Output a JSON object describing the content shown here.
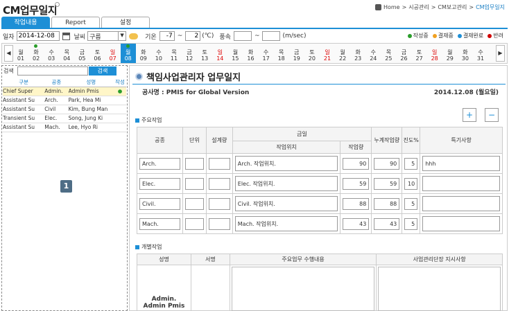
{
  "app": {
    "title": "CM업무일지"
  },
  "breadcrumb": {
    "home": "Home",
    "level1": "시공관리",
    "level2": "CM보고관리",
    "current": "CM업무일지"
  },
  "tabs": [
    {
      "label": "작업내용"
    },
    {
      "label": "Report"
    },
    {
      "label": "설정"
    }
  ],
  "toolbar": {
    "date_label": "일자",
    "date_value": "2014-12-08",
    "weather_label": "날씨",
    "weather_value": "구름",
    "temp_label": "기온",
    "temp_min": "-7",
    "temp_sep": "~",
    "temp_max": "2",
    "temp_unit": "(℃)",
    "wind_label": "풍속",
    "wind_min": "",
    "wind_sep": "~",
    "wind_max": "",
    "wind_unit": "(m/sec)"
  },
  "status_legend": [
    {
      "label": "작성중",
      "color": "#2a9d2a"
    },
    {
      "label": "결재중",
      "color": "#f0a020"
    },
    {
      "label": "결재완료",
      "color": "#1d8fd6"
    },
    {
      "label": "반려",
      "color": "#d00000"
    }
  ],
  "calendar": {
    "days": [
      {
        "w": "월",
        "d": "01"
      },
      {
        "w": "화",
        "d": "02",
        "dot": true
      },
      {
        "w": "수",
        "d": "03"
      },
      {
        "w": "목",
        "d": "04"
      },
      {
        "w": "금",
        "d": "05"
      },
      {
        "w": "토",
        "d": "06"
      },
      {
        "w": "일",
        "d": "07",
        "red": true
      },
      {
        "w": "월",
        "d": "08",
        "sel": true,
        "dot": true
      },
      {
        "w": "화",
        "d": "09"
      },
      {
        "w": "수",
        "d": "10"
      },
      {
        "w": "목",
        "d": "11"
      },
      {
        "w": "금",
        "d": "12"
      },
      {
        "w": "토",
        "d": "13"
      },
      {
        "w": "일",
        "d": "14",
        "red": true
      },
      {
        "w": "월",
        "d": "15"
      },
      {
        "w": "화",
        "d": "16"
      },
      {
        "w": "수",
        "d": "17"
      },
      {
        "w": "목",
        "d": "18"
      },
      {
        "w": "금",
        "d": "19"
      },
      {
        "w": "토",
        "d": "20"
      },
      {
        "w": "일",
        "d": "21",
        "red": true
      },
      {
        "w": "월",
        "d": "22"
      },
      {
        "w": "화",
        "d": "23"
      },
      {
        "w": "수",
        "d": "24"
      },
      {
        "w": "목",
        "d": "25"
      },
      {
        "w": "금",
        "d": "26"
      },
      {
        "w": "토",
        "d": "27"
      },
      {
        "w": "일",
        "d": "28",
        "red": true
      },
      {
        "w": "월",
        "d": "29"
      },
      {
        "w": "화",
        "d": "30"
      },
      {
        "w": "수",
        "d": "31"
      }
    ]
  },
  "left_panel": {
    "search_label": "검색",
    "search_value": "",
    "search_button": "검색",
    "headers": [
      "구분",
      "공종",
      "성명",
      "작성"
    ],
    "rows": [
      [
        "Chief Super",
        "Admin.",
        "Admin Pmis",
        "●"
      ],
      [
        "Assistant Su",
        "Arch.",
        "Park, Hea Mi",
        ""
      ],
      [
        "Assistant Su",
        "Civil",
        "Kim, Bung Man",
        ""
      ],
      [
        "Transient Su",
        "Elec.",
        "Song, Jung Ki",
        ""
      ],
      [
        "Assistant Su",
        "Mach.",
        "Lee, Hyo Ri",
        ""
      ]
    ],
    "badge": "1"
  },
  "main": {
    "title": "책임사업관리자 업무일지",
    "project_label": "공사명 : PMIS for Global Version",
    "date_text": "2014.12.08 (월요일)",
    "section1": "주요작업",
    "add_button": "+",
    "remove_button": "−",
    "work_headers": {
      "trade": "공종",
      "unit": "단위",
      "design_qty": "설계량",
      "today": "금일",
      "location": "작업위치",
      "work_qty": "작업량",
      "cum_qty": "누계작업량",
      "progress": "진도%",
      "note": "특기사항"
    },
    "work_rows": [
      {
        "trade": "Arch.",
        "unit": "",
        "design": "",
        "location": "Arch. 작업위치.",
        "qty": "90",
        "cum": "90",
        "progress": "5",
        "note": "hhh"
      },
      {
        "trade": "Elec.",
        "unit": "",
        "design": "",
        "location": "Elec. 작업위치.",
        "qty": "59",
        "cum": "59",
        "progress": "10",
        "note": ""
      },
      {
        "trade": "Civil.",
        "unit": "",
        "design": "",
        "location": "Civil. 작업위치.",
        "qty": "88",
        "cum": "88",
        "progress": "5",
        "note": ""
      },
      {
        "trade": "Mach.",
        "unit": "",
        "design": "",
        "location": "Mach. 작업위치.",
        "qty": "43",
        "cum": "43",
        "progress": "5",
        "note": ""
      }
    ],
    "section2": "개별작업",
    "ind_headers": {
      "name": "성명",
      "sign": "서명",
      "main_work": "주요업무 수행내용",
      "instruction": "사업관리단장 지시사항"
    },
    "ind_name": "Admin.\nAdmin Pmis"
  }
}
